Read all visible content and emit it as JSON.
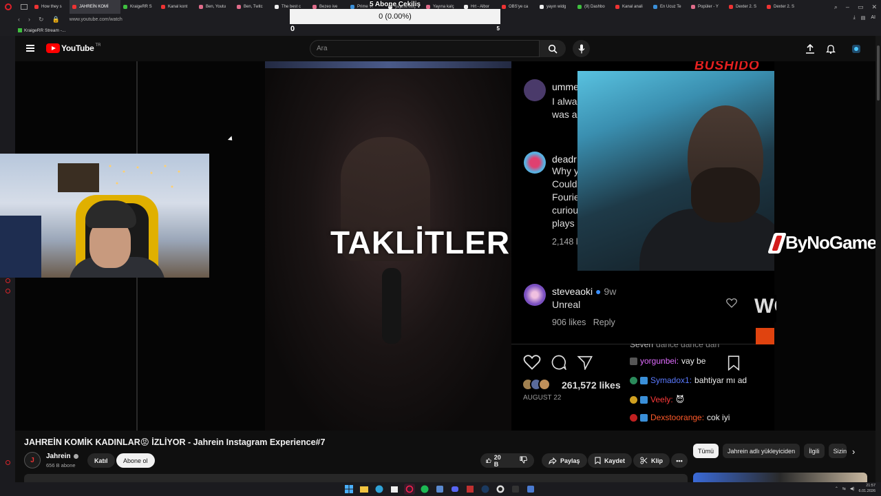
{
  "browser": {
    "tabs": [
      {
        "label": "How they s",
        "color": "#e33"
      },
      {
        "label": "JAHREİN KOMİ",
        "color": "#e33",
        "active": true
      },
      {
        "label": "KraigeRR S",
        "color": "#3fbf3f"
      },
      {
        "label": "Kanal kont",
        "color": "#e33"
      },
      {
        "label": "Ben, Youtu",
        "color": "#e06c8a"
      },
      {
        "label": "Ben, Twitc",
        "color": "#e06c8a"
      },
      {
        "label": "The best c",
        "color": "#eee"
      },
      {
        "label": "Bezeo ive",
        "color": "#e06c8a"
      },
      {
        "label": "Prime Vi",
        "color": "#3a8fd8"
      },
      {
        "label": "yayına kalç",
        "color": "#eee"
      },
      {
        "label": "Yayına kalç",
        "color": "#e06c8a"
      },
      {
        "label": "Hrt - Albor",
        "color": "#eee"
      },
      {
        "label": "OBS'ye ca",
        "color": "#e33"
      },
      {
        "label": "yayın widg",
        "color": "#eee"
      },
      {
        "label": "(9) Dashbo",
        "color": "#3fbf3f"
      },
      {
        "label": "Kanal anali",
        "color": "#e33"
      },
      {
        "label": "En Ucuz Te",
        "color": "#3a8fd8"
      },
      {
        "label": "Popüler - Y",
        "color": "#e06c8a"
      },
      {
        "label": "Dexter 2. S",
        "color": "#e33"
      },
      {
        "label": "Dexter 2. S",
        "color": "#e33"
      }
    ],
    "url": "www.youtube.com/watch",
    "bookmark": "KraigeRR Stream -...",
    "right_tools": "AI"
  },
  "goal_widget": {
    "title": "5 Abone Çekiliş",
    "progress_text": "0 (0.00%)",
    "min": "0",
    "max": "5",
    "progress_fraction": 0
  },
  "youtube": {
    "logo_text": "YouTube",
    "region": "TR",
    "search_placeholder": "Ara"
  },
  "video": {
    "overlay_title": "TAKLİTLER",
    "bushido_text": "BUSHIDO",
    "wo_text": "WO",
    "sponsor": "ByNoGame",
    "instagram": {
      "comments": [
        {
          "name": "umme",
          "lines": [
            "I alwa",
            "was a"
          ],
          "color": "#4a3a6a"
        },
        {
          "name": "deadr",
          "lines": [
            "Why y",
            "Could",
            "Fourie",
            "curiou",
            "plays"
          ],
          "color": "#5ab0e0"
        }
      ],
      "comment_meta": "2,148 l",
      "featured": {
        "name": "steveaoki",
        "time": "9w",
        "text": "Unreal",
        "likes": "906 likes",
        "reply": "Reply"
      },
      "post_likes": "261,572 likes",
      "post_date": "AUGUST 22"
    },
    "chat": [
      {
        "user": "Seven",
        "msg": "dance dance dan",
        "user_color": "#bbb"
      },
      {
        "user": "yorgunbei:",
        "msg": "vay be",
        "user_color": "#e06cff"
      },
      {
        "user": "Symadox1:",
        "msg": "bahtiyar mı ad",
        "user_color": "#5aa0ff"
      },
      {
        "user": "Veely:",
        "msg": "😈",
        "user_color": "#ff4545"
      },
      {
        "user": "Dexstoorange:",
        "msg": "cok iyi",
        "user_color": "#ff5a2a"
      }
    ]
  },
  "meta": {
    "title": "JAHREİN KOMİK KADINLAR😡 İZLİYOR - Jahrein Instagram Experience#7",
    "channel": "Jahrein",
    "subscribers": "656 B abone",
    "join_label": "Katıl",
    "subscribe_label": "Abone ol",
    "like_count": "20 B",
    "share_label": "Paylaş",
    "save_label": "Kaydet",
    "clip_label": "Klip",
    "more_label": "•••"
  },
  "chips": [
    "Tümü",
    "Jahrein adlı yükleyiciden",
    "İlgili",
    "Sizin"
  ],
  "taskbar": {
    "time": "21:57",
    "date": "6.01.2026"
  }
}
